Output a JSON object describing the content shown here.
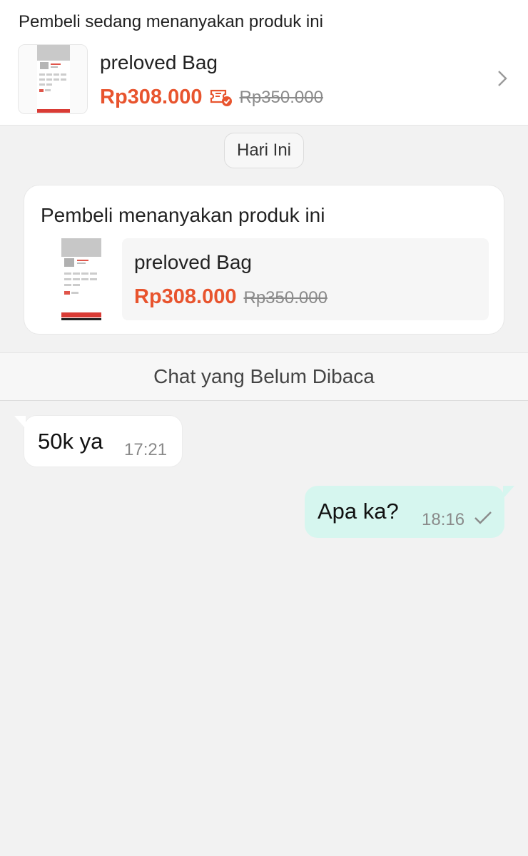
{
  "banner": {
    "title": "Pembeli sedang menanyakan produk ini",
    "product_name": "preloved Bag",
    "price": "Rp308.000",
    "old_price": "Rp350.000",
    "icons": [
      "voucher-check-icon",
      "chevron-right-icon"
    ]
  },
  "date_label": "Hari Ini",
  "inquiry_card": {
    "title": "Pembeli menanyakan produk ini",
    "product_name": "preloved Bag",
    "price": "Rp308.000",
    "old_price": "Rp350.000"
  },
  "unread_label": "Chat yang Belum Dibaca",
  "messages": [
    {
      "direction": "incoming",
      "text": "50k ya",
      "time": "17:21"
    },
    {
      "direction": "outgoing",
      "text": "Apa ka?",
      "time": "18:16",
      "status_icon": "check-icon"
    }
  ],
  "colors": {
    "price": "#e8542e",
    "outgoing_bubble": "#d6f6ef",
    "background": "#f2f2f2"
  }
}
